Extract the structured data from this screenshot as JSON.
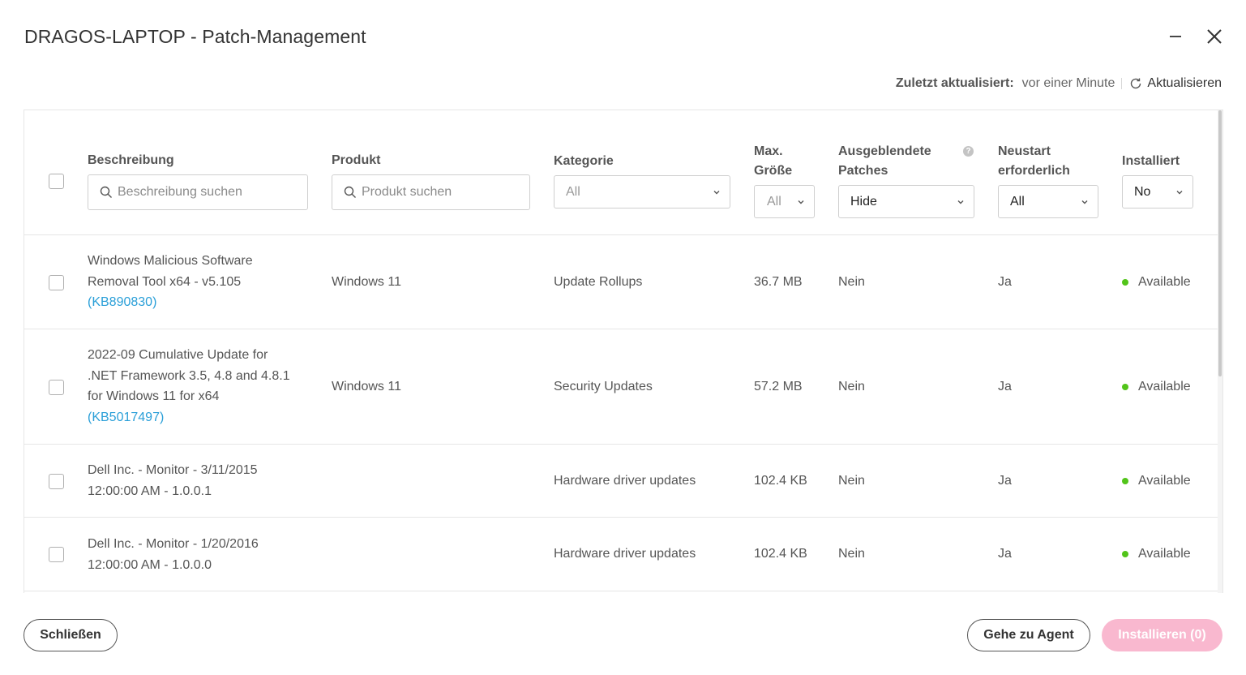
{
  "window": {
    "title": "DRAGOS-LAPTOP - Patch-Management"
  },
  "refresh": {
    "label": "Zuletzt aktualisiert:",
    "value": "vor einer Minute",
    "button": "Aktualisieren"
  },
  "columns": {
    "description": {
      "label": "Beschreibung",
      "placeholder": "Beschreibung suchen"
    },
    "product": {
      "label": "Produkt",
      "placeholder": "Produkt suchen"
    },
    "category": {
      "label": "Kategorie",
      "value": "All"
    },
    "max_size": {
      "label_1": "Max.",
      "label_2": "Größe",
      "value": "All"
    },
    "hidden": {
      "label_1": "Ausgeblendete",
      "label_2": "Patches",
      "value": "Hide",
      "info": "?"
    },
    "restart": {
      "label_1": "Neustart",
      "label_2": "erforderlich",
      "value": "All"
    },
    "installed": {
      "label": "Installiert",
      "value": "No"
    }
  },
  "rows": [
    {
      "desc_1": "Windows Malicious Software",
      "desc_2": "Removal Tool x64 - v5.105",
      "kb": "(KB890830)",
      "product": "Windows 11",
      "category": "Update Rollups",
      "size": "36.7 MB",
      "hidden": "Nein",
      "restart": "Ja",
      "status": "Available"
    },
    {
      "desc_1": "2022-09 Cumulative Update for",
      "desc_2": ".NET Framework 3.5, 4.8 and 4.8.1",
      "desc_3": "for Windows 11 for x64",
      "kb": "(KB5017497)",
      "product": "Windows 11",
      "category": "Security Updates",
      "size": "57.2 MB",
      "hidden": "Nein",
      "restart": "Ja",
      "status": "Available"
    },
    {
      "desc_1": "Dell Inc. - Monitor - 3/11/2015",
      "desc_2": "12:00:00 AM - 1.0.0.1",
      "product": "",
      "category": "Hardware driver updates",
      "size": "102.4 KB",
      "hidden": "Nein",
      "restart": "Ja",
      "status": "Available"
    },
    {
      "desc_1": "Dell Inc. - Monitor - 1/20/2016",
      "desc_2": "12:00:00 AM - 1.0.0.0",
      "product": "",
      "category": "Hardware driver updates",
      "size": "102.4 KB",
      "hidden": "Nein",
      "restart": "Ja",
      "status": "Available"
    }
  ],
  "footer": {
    "close": "Schließen",
    "agent": "Gehe zu Agent",
    "install": "Installieren (0)"
  },
  "colors": {
    "accent_link": "#2a9fd8",
    "status_available": "#52c41a",
    "install_disabled": "#f9b8cf"
  }
}
